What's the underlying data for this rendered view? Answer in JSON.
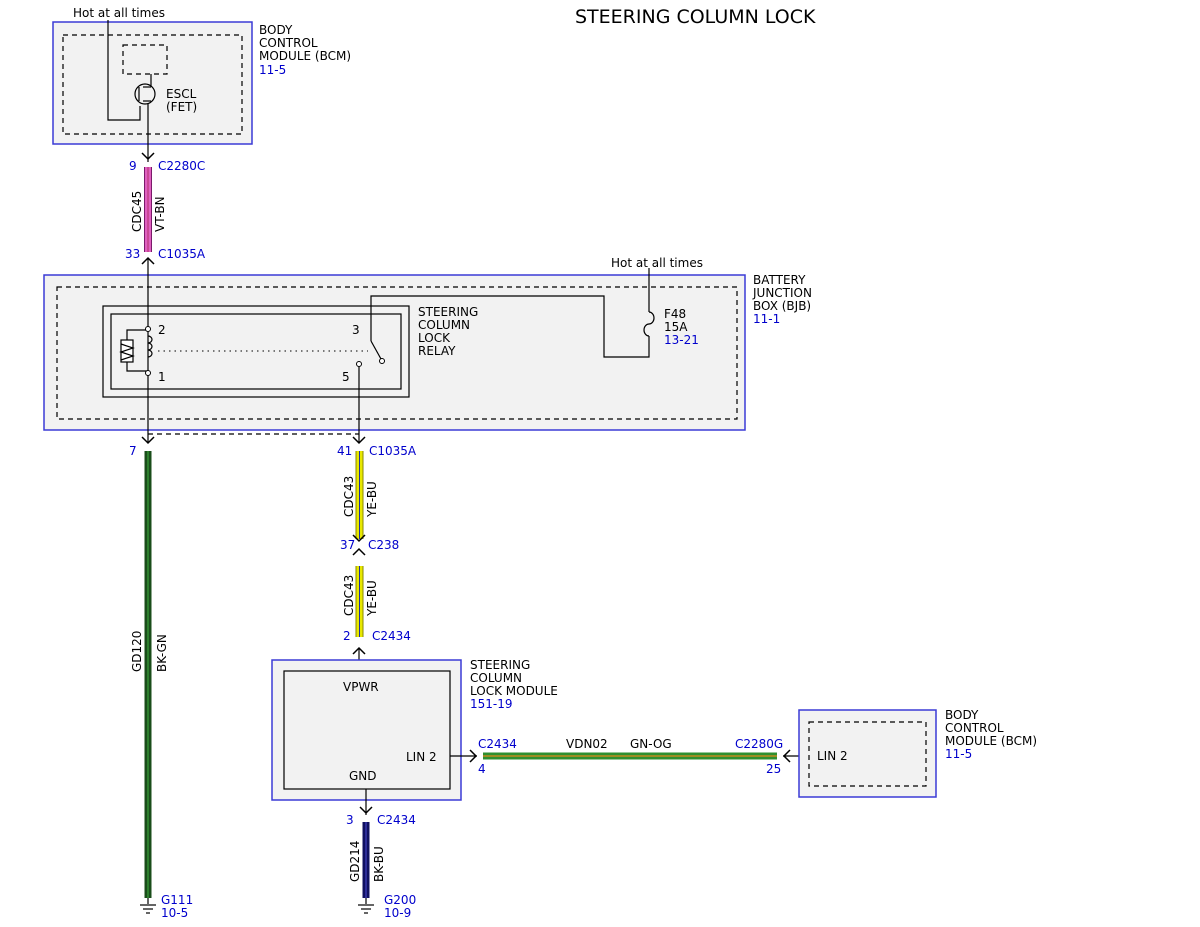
{
  "title": "STEERING COLUMN LOCK",
  "hot_at_all_times_top": "Hot at all times",
  "hot_at_all_times_bjb": "Hot at all times",
  "bcm_top": {
    "name_lines": [
      "BODY",
      "CONTROL",
      "MODULE (BCM)"
    ],
    "ref": "11-5",
    "component_lines": [
      "ESCL",
      "(FET)"
    ]
  },
  "bjb": {
    "name_lines": [
      "BATTERY",
      "JUNCTION",
      "BOX (BJB)"
    ],
    "ref": "11-1",
    "relay_lines": [
      "STEERING",
      "COLUMN",
      "LOCK",
      "RELAY"
    ],
    "pins": {
      "p2": "2",
      "p3": "3",
      "p1": "1",
      "p5": "5"
    },
    "fuse": {
      "name": "F48",
      "rating": "15A",
      "ref": "13-21"
    }
  },
  "sclm": {
    "name_lines": [
      "STEERING",
      "COLUMN",
      "LOCK MODULE"
    ],
    "ref": "151-19",
    "vpwr": "VPWR",
    "gnd": "GND",
    "lin": "LIN 2"
  },
  "bcm_right": {
    "name_lines": [
      "BODY",
      "CONTROL",
      "MODULE (BCM)"
    ],
    "ref": "11-5",
    "lin": "LIN 2"
  },
  "connectors": {
    "bcm_pin": "9",
    "bcm_conn": "C2280C",
    "bjb_in_pin": "33",
    "bjb_in_conn": "C1035A",
    "bjb_out7_pin": "7",
    "bjb_out41_pin": "41",
    "bjb_out41_conn": "C1035A",
    "c238_pin": "37",
    "c238_conn": "C238",
    "sclm_vpwr_pin": "2",
    "sclm_vpwr_conn": "C2434",
    "sclm_lin_conn": "C2434",
    "sclm_lin_pin": "4",
    "bcm_lin_conn": "C2280G",
    "bcm_lin_pin": "25",
    "sclm_gnd_pin": "3",
    "sclm_gnd_conn": "C2434"
  },
  "wires": {
    "cdc45": {
      "circuit": "CDC45",
      "color": "VT-BN",
      "hex": "#e060c0"
    },
    "cdc43_a": {
      "circuit": "CDC43",
      "color": "YE-BU",
      "hex": "#e8e800"
    },
    "cdc43_b": {
      "circuit": "CDC43",
      "color": "YE-BU",
      "hex": "#e8e800"
    },
    "gd120": {
      "circuit": "GD120",
      "color": "BK-GN",
      "hex": "#1a4d1a"
    },
    "vdn02": {
      "circuit": "VDN02",
      "color": "GN-OG",
      "hex": "#2f8f2f"
    },
    "gd214": {
      "circuit": "GD214",
      "color": "BK-BU",
      "hex": "#101060"
    }
  },
  "grounds": {
    "g111": {
      "name": "G111",
      "ref": "10-5"
    },
    "g200": {
      "name": "G200",
      "ref": "10-9"
    }
  }
}
